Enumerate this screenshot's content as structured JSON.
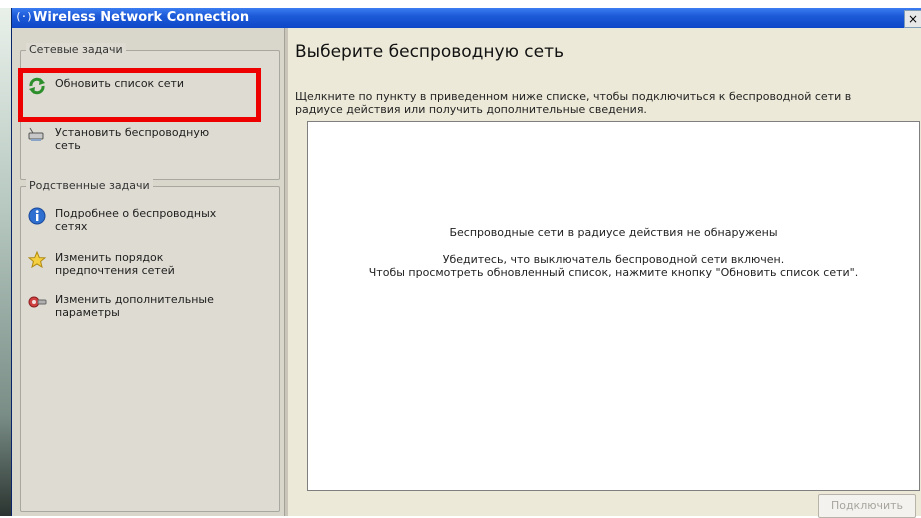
{
  "window": {
    "title": "Wireless Network Connection",
    "title_icon": "(·)",
    "close_glyph": "×"
  },
  "left_pane": {
    "network_tasks": {
      "title": "Сетевые задачи",
      "items": [
        {
          "label": "Обновить список сети",
          "icon": "refresh-icon"
        },
        {
          "label": "Установить беспроводную сеть",
          "icon": "wireless-setup-icon"
        }
      ]
    },
    "related_tasks": {
      "title": "Родственные задачи",
      "items": [
        {
          "label": "Подробнее о беспроводных сетях",
          "icon": "info-icon"
        },
        {
          "label": "Изменить порядок предпочтения сетей",
          "icon": "star-icon"
        },
        {
          "label": "Изменить дополнительные параметры",
          "icon": "settings-icon"
        }
      ]
    }
  },
  "right_pane": {
    "heading": "Выберите беспроводную сеть",
    "description": "Щелкните по пункту в приведенном ниже списке, чтобы подключиться к беспроводной сети в радиусе действия или получить дополнительные сведения.",
    "empty_message": {
      "line1": "Беспроводные сети в радиусе действия не обнаружены",
      "line2": "Убедитесь, что выключатель беспроводной сети включен.",
      "line3": "Чтобы просмотреть обновленный список, нажмите кнопку \"Обновить список сети\"."
    },
    "connect_button": "Подключить"
  },
  "colors": {
    "highlight": "#ee0000",
    "titlebar": "#0e47c7"
  }
}
